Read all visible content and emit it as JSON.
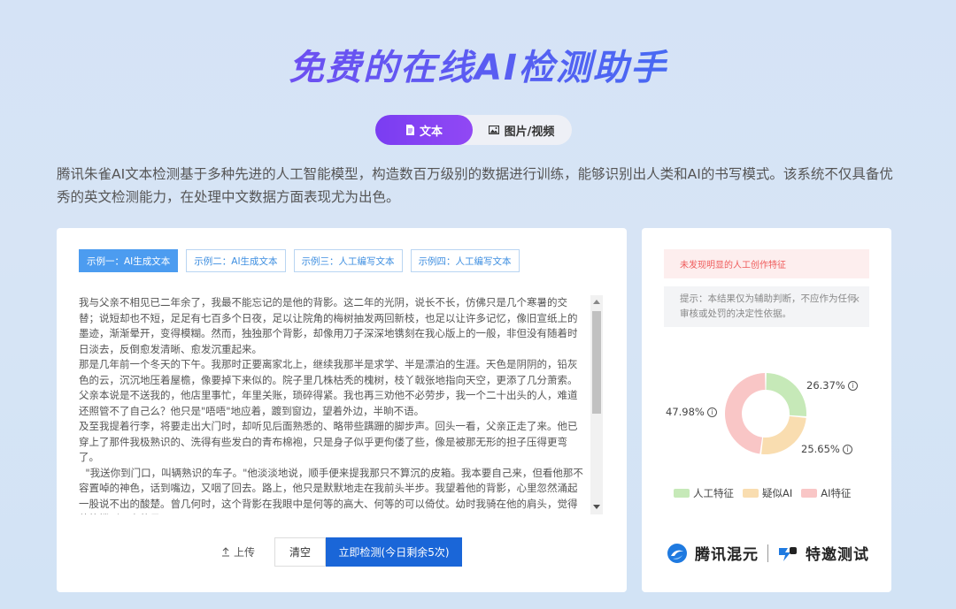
{
  "hero": {
    "title": "免费的在线AI检测助手"
  },
  "tabs": [
    {
      "label": "文本",
      "icon": "document-icon",
      "active": true
    },
    {
      "label": "图片/视频",
      "icon": "image-icon",
      "active": false
    }
  ],
  "intro": "腾讯朱雀AI文本检测基于多种先进的人工智能模型，构造数百万级别的数据进行训练，能够识别出人类和AI的书写模式。该系统不仅具备优秀的英文检测能力，在处理中文数据方面表现尤为出色。",
  "examples": [
    {
      "label": "示例一：AI生成文本",
      "active": true
    },
    {
      "label": "示例二：AI生成文本",
      "active": false
    },
    {
      "label": "示例三：人工编写文本",
      "active": false
    },
    {
      "label": "示例四：人工编写文本",
      "active": false
    }
  ],
  "article": "我与父亲不相见已二年余了，我最不能忘记的是他的背影。这二年的光阴，说长不长，仿佛只是几个寒暑的交替；说短却也不短，足足有七百多个日夜，足以让院角的梅树抽发两回新枝，也足以让许多记忆，像旧宣纸上的墨迹，渐渐晕开，变得模糊。然而，独独那个背影，却像用刀子深深地镌刻在我心版上的一般，非但没有随着时日淡去，反倒愈发清晰、愈发沉重起来。\n那是几年前一个冬天的下午。我那时正要离家北上，继续我那半是求学、半是漂泊的生涯。天色是阴阴的，铅灰色的云，沉沉地压着屋檐，像要掉下来似的。院子里几株枯秃的槐树，枝丫戟张地指向天空，更添了几分萧索。父亲本说是不送我的，他店里事忙，年里关账，琐碎得紧。我也再三劝他不必劳步，我一个二十出头的人，难道还照管不了自己么？他只是\"唔唔\"地应着，踱到窗边，望着外边，半晌不语。\n及至我提着行李，将要走出大门时，却听见后面熟悉的、略带些蹒跚的脚步声。回头一看，父亲正走了来。他已穿上了那件我极熟识的、洗得有些发白的青布棉袍，只是身子似乎更佝偻了些，像是被那无形的担子压得更弯了。\n  \"我送你到门口，叫辆熟识的车子。\"他淡淡地说，顺手便来提我那只不算沉的皮箱。我本要自己来，但看他那不容置啅的神色，话到嘴边，又咽了回去。路上，他只是默默地走在我前头半步。我望着他的背影，心里忽然涌起一股说不出的酸楚。曾几何时，这个背影在我眼中是何等的高大、何等的可以倚仗。幼时我骑在他的肩头，觉得他能撑到天上的星子。",
  "actions": {
    "upload": "上传",
    "clear": "清空",
    "detect": "立即检测(今日剩余5次)"
  },
  "result": {
    "warning": "未发现明显的人工创作特征",
    "hint": "提示：本结果仅为辅助判断，不应作为任何审核或处罚的决定性依据。",
    "hint_close": "×"
  },
  "chart_data": {
    "type": "pie",
    "donut": true,
    "slices": [
      {
        "name": "人工特征",
        "value": 26.37,
        "label": "26.37%",
        "color": "#c6e9b8"
      },
      {
        "name": "疑似AI",
        "value": 25.65,
        "label": "25.65%",
        "color": "#f9ddb0"
      },
      {
        "name": "AI特征",
        "value": 47.98,
        "label": "47.98%",
        "color": "#f9c6c6"
      }
    ],
    "legend_position": "bottom"
  },
  "logos": {
    "left": "腾讯混元",
    "right": "特邀测试"
  },
  "colors": {
    "primary": "#1a66d8",
    "accent": "#8a3cf0",
    "example_active": "#4c9cf0"
  }
}
